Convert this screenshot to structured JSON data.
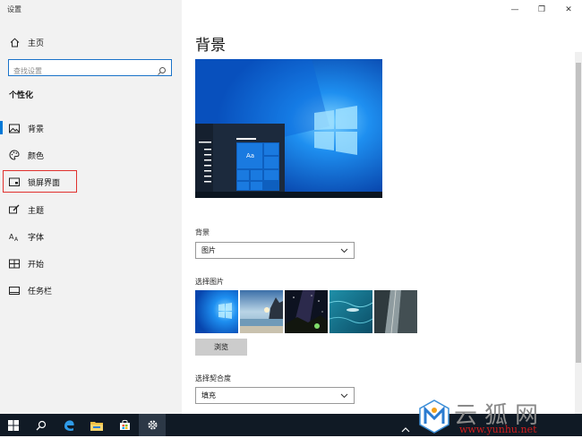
{
  "app": {
    "title": "设置"
  },
  "sidebar": {
    "home_label": "主页",
    "search_placeholder": "查找设置",
    "section_title": "个性化",
    "items": [
      {
        "label": "背景",
        "icon": "image-icon",
        "active": true
      },
      {
        "label": "颜色",
        "icon": "palette-icon"
      },
      {
        "label": "锁屏界面",
        "icon": "lock-screen-icon",
        "highlighted": true
      },
      {
        "label": "主题",
        "icon": "theme-brush-icon"
      },
      {
        "label": "字体",
        "icon": "font-icon"
      },
      {
        "label": "开始",
        "icon": "start-grid-icon"
      },
      {
        "label": "任务栏",
        "icon": "taskbar-icon"
      }
    ]
  },
  "main": {
    "title": "背景",
    "preview_tile_text": "Aa",
    "background_label": "背景",
    "background_value": "图片",
    "choose_picture_label": "选择图片",
    "browse_label": "浏览",
    "fit_label": "选择契合度",
    "fit_value": "填充"
  },
  "window_controls": {
    "minimize": "—",
    "restore": "❐",
    "close": "✕"
  },
  "taskbar": {
    "items": [
      "start-icon",
      "search-icon",
      "edge-icon",
      "file-explorer-icon",
      "store-icon",
      "settings-icon"
    ]
  },
  "watermark": {
    "text": "云狐网",
    "url": "www.yunhu.net"
  },
  "colors": {
    "accent": "#0078d7",
    "highlight_border": "#e0312e",
    "taskbar": "#101a25",
    "sidebar_bg": "#f2f2f2"
  }
}
